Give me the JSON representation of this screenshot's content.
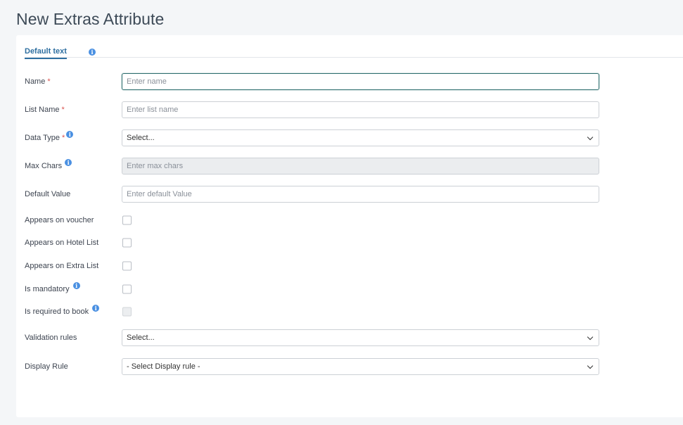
{
  "page": {
    "title": "New Extras Attribute"
  },
  "tabs": [
    {
      "label": "Default text"
    }
  ],
  "form": {
    "name": {
      "label": "Name",
      "required": "*",
      "placeholder": "Enter name"
    },
    "list_name": {
      "label": "List Name",
      "required": "*",
      "placeholder": "Enter list name"
    },
    "data_type": {
      "label": "Data Type",
      "required": "*",
      "value": "Select..."
    },
    "max_chars": {
      "label": "Max Chars",
      "placeholder": "Enter max chars"
    },
    "default_value": {
      "label": "Default Value",
      "placeholder": "Enter default Value"
    },
    "appears_on_voucher": {
      "label": "Appears on voucher"
    },
    "appears_on_hotel_list": {
      "label": "Appears on Hotel List"
    },
    "appears_on_extra_list": {
      "label": "Appears on Extra List"
    },
    "is_mandatory": {
      "label": "Is mandatory"
    },
    "is_required_to_book": {
      "label": "Is required to book"
    },
    "validation_rules": {
      "label": "Validation rules",
      "value": "Select..."
    },
    "display_rule": {
      "label": "Display Rule",
      "value": "- Select Display rule -"
    }
  },
  "icons": {
    "info": "i"
  },
  "colors": {
    "accent": "#2f6fa0",
    "required": "#d9534f",
    "info": "#4a90e2"
  }
}
